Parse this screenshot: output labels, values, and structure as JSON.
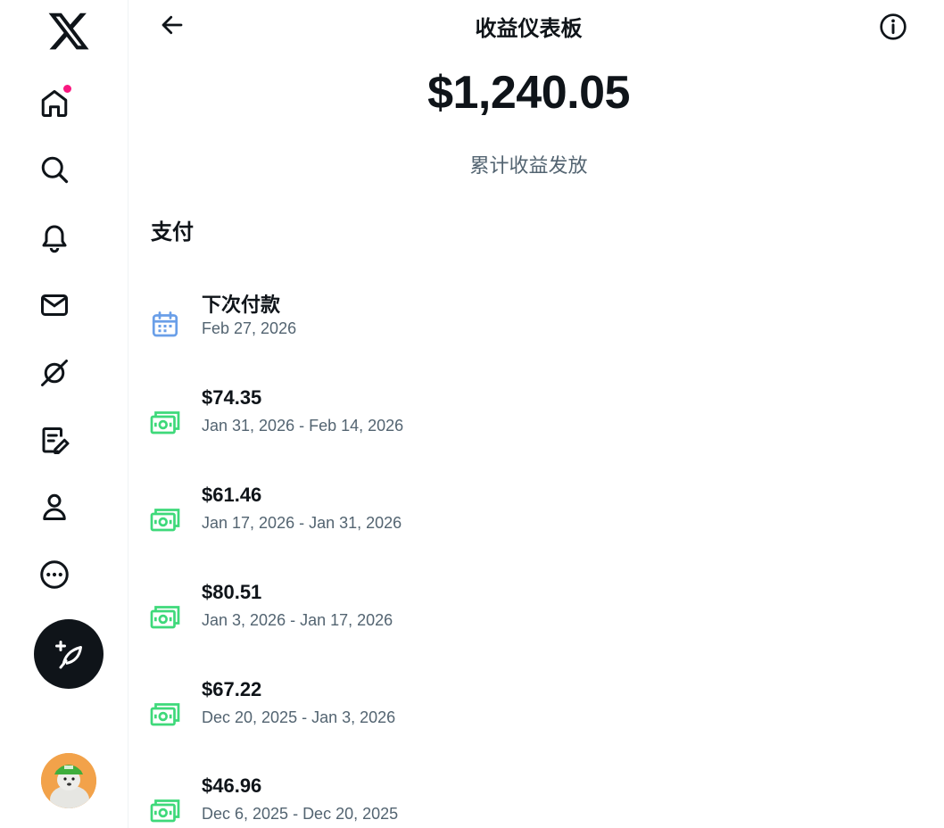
{
  "colors": {
    "accent_notification": "#f91880",
    "text_primary": "#0f1419",
    "text_secondary": "#536471",
    "calendar_icon": "#6a9fe8",
    "money_icon": "#3ed97a"
  },
  "sidebar": {
    "items": [
      {
        "name": "home",
        "icon": "home-icon",
        "has_notification": true
      },
      {
        "name": "explore",
        "icon": "search-icon"
      },
      {
        "name": "notifications",
        "icon": "bell-icon"
      },
      {
        "name": "messages",
        "icon": "envelope-icon"
      },
      {
        "name": "grok",
        "icon": "grok-icon"
      },
      {
        "name": "articles",
        "icon": "compose-article-icon"
      },
      {
        "name": "profile",
        "icon": "person-icon"
      },
      {
        "name": "more",
        "icon": "more-circle-icon"
      }
    ],
    "compose_icon": "feather-plus-icon",
    "avatar_icon": "avatar"
  },
  "header": {
    "title": "收益仪表板",
    "back_icon": "back-arrow-icon",
    "info_icon": "info-icon"
  },
  "earnings": {
    "total": "$1,240.05",
    "caption": "累计收益发放"
  },
  "payments": {
    "section_title": "支付",
    "next": {
      "label": "下次付款",
      "date": "Feb 27, 2026",
      "icon": "calendar-icon"
    },
    "history": [
      {
        "amount": "$74.35",
        "period": "Jan 31, 2026 - Feb 14, 2026",
        "icon": "money-icon"
      },
      {
        "amount": "$61.46",
        "period": "Jan 17, 2026 - Jan 31, 2026",
        "icon": "money-icon"
      },
      {
        "amount": "$80.51",
        "period": "Jan 3, 2026 - Jan 17, 2026",
        "icon": "money-icon"
      },
      {
        "amount": "$67.22",
        "period": "Dec 20, 2025 - Jan 3, 2026",
        "icon": "money-icon"
      },
      {
        "amount": "$46.96",
        "period": "Dec 6, 2025 - Dec 20, 2025",
        "icon": "money-icon"
      }
    ]
  }
}
